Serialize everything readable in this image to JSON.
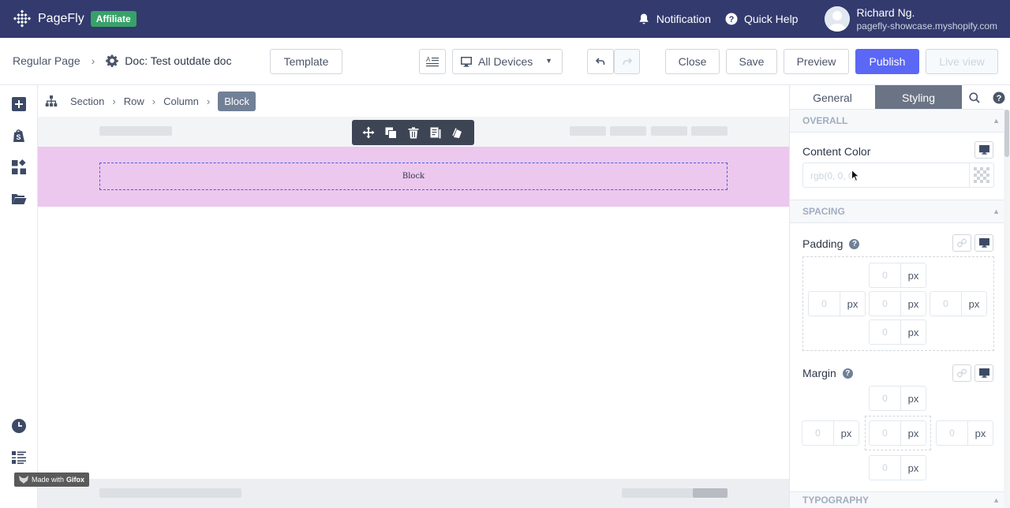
{
  "topbar": {
    "app_name": "PageFly",
    "badge": "Affiliate",
    "notification_label": "Notification",
    "quick_help_label": "Quick Help",
    "user_name": "Richard Ng.",
    "user_store": "pagefly-showcase.myshopify.com"
  },
  "toolbar": {
    "breadcrumb_root": "Regular Page",
    "doc_title": "Doc: Test outdate doc",
    "template_label": "Template",
    "device_label": "All Devices",
    "close_label": "Close",
    "save_label": "Save",
    "preview_label": "Preview",
    "publish_label": "Publish",
    "live_view_label": "Live view"
  },
  "element_breadcrumb": {
    "items": [
      "Section",
      "Row",
      "Column",
      "Block"
    ]
  },
  "canvas": {
    "block_text": "Block",
    "gifox_prefix": "Made with",
    "gifox_brand": "Gifox"
  },
  "panel": {
    "tabs": [
      "General",
      "Styling"
    ],
    "active_tab": "Styling",
    "overall_header": "OVERALL",
    "content_color_label": "Content Color",
    "content_color_value": "rgb(0, 0, 0)",
    "spacing_header": "SPACING",
    "padding_label": "Padding",
    "padding": {
      "top": "0",
      "left": "0",
      "center": "0",
      "right": "0",
      "bottom": "0",
      "unit": "px"
    },
    "margin_label": "Margin",
    "margin": {
      "top": "0",
      "left": "0",
      "center": "0",
      "right": "0",
      "bottom": "0",
      "unit": "px"
    },
    "typography_header": "TYPOGRAPHY"
  },
  "colors": {
    "topbar_bg": "#333a6e",
    "affiliate_badge": "#38a169",
    "publish_bg": "#5b67f5",
    "section_bg": "#ecc7ee",
    "block_border": "#4a5fd6"
  }
}
